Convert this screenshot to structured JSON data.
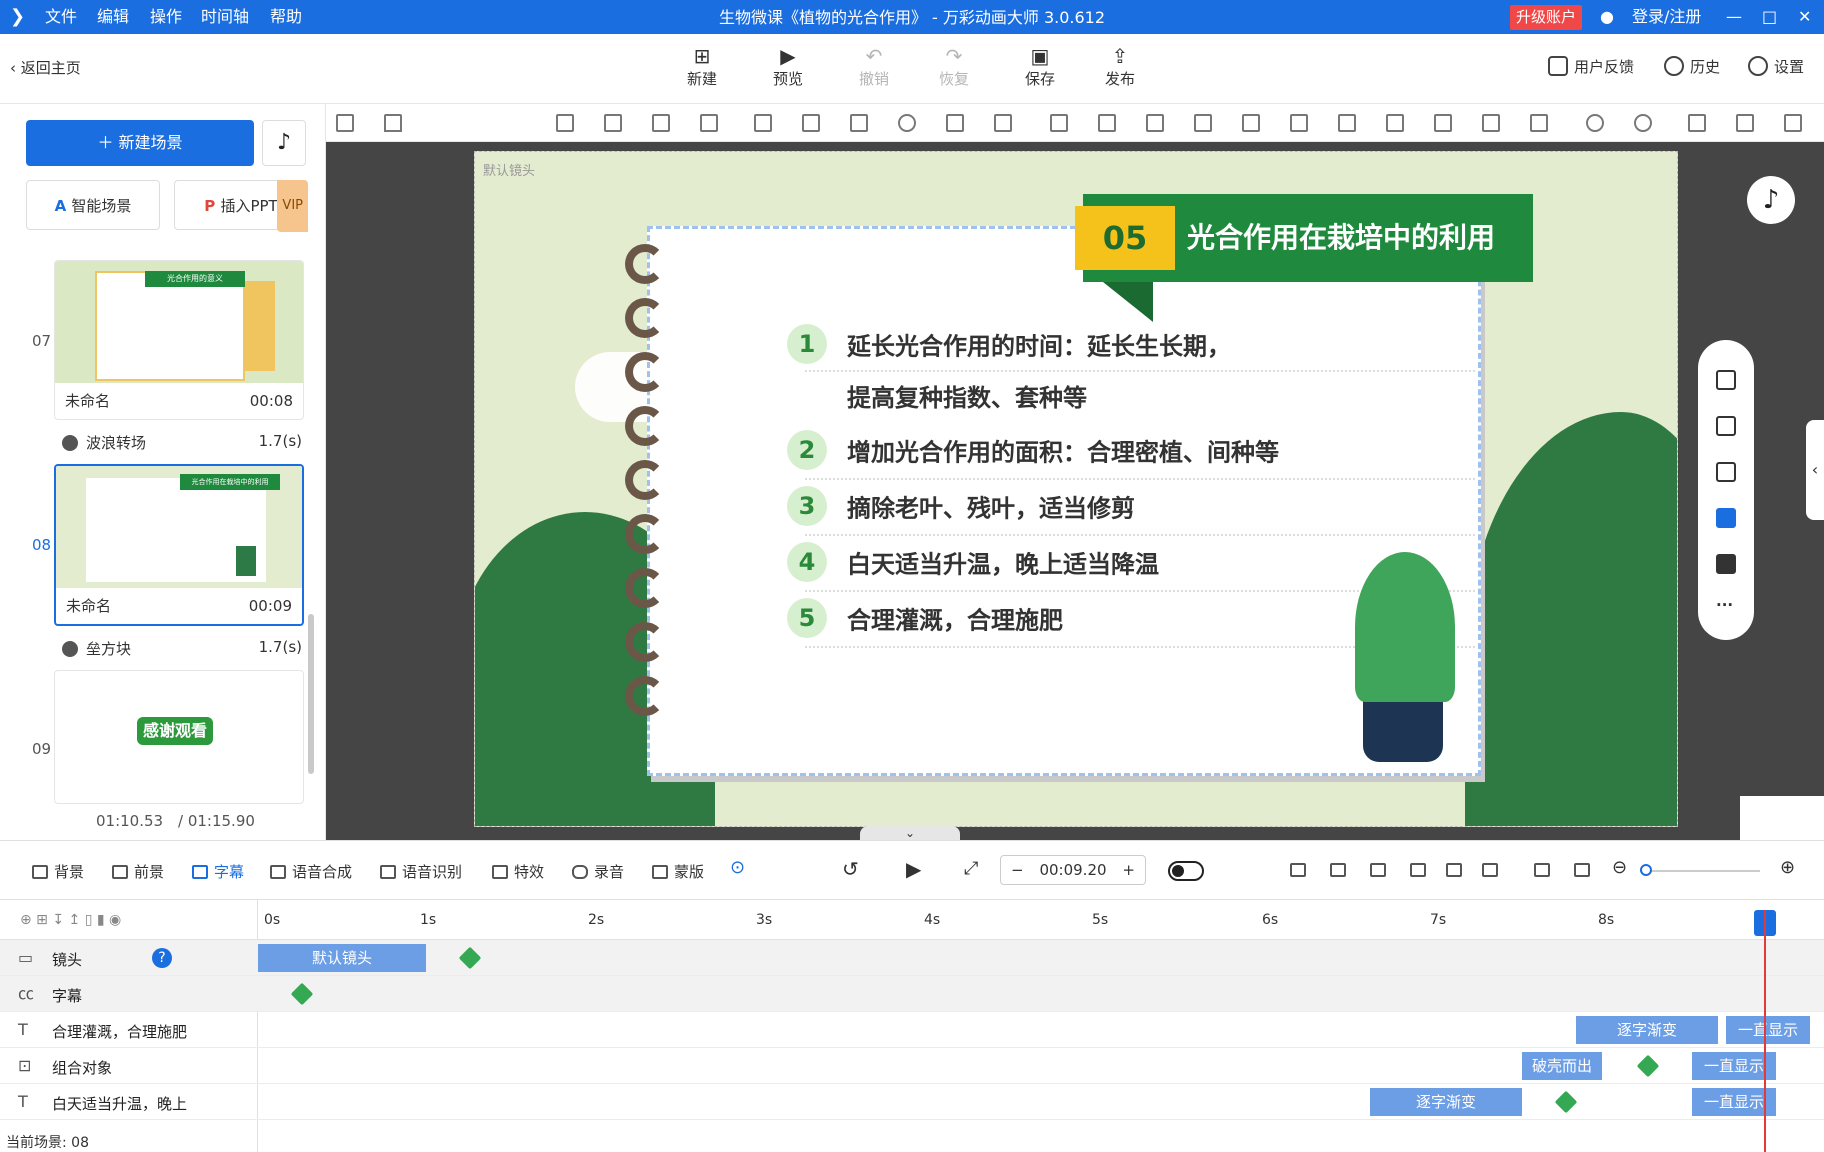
{
  "titlebar": {
    "menus": [
      "文件",
      "编辑",
      "操作",
      "时间轴",
      "帮助"
    ],
    "title": "生物微课《植物的光合作用》 - 万彩动画大师 3.0.612",
    "upgrade": "升级账户",
    "login": "登录/注册"
  },
  "toolbar": {
    "back": "返回主页",
    "buttons": [
      "新建",
      "预览",
      "撤销",
      "恢复",
      "保存",
      "发布"
    ],
    "feedback": "用户反馈",
    "history": "历史",
    "settings": "设置"
  },
  "left": {
    "new_scene": "新建场景",
    "smart_scene": "智能场景",
    "insert_ppt": "插入PPT",
    "vip": "VIP",
    "scenes": [
      {
        "num": "07",
        "name": "未命名",
        "dur": "00:08",
        "transition": "波浪转场",
        "tdur": "1.7(s)",
        "thumb_title": "光合作用的意义"
      },
      {
        "num": "08",
        "name": "未命名",
        "dur": "00:09",
        "transition": "垒方块",
        "tdur": "1.7(s)",
        "thumb_title": "光合作用在栽培中的利用"
      },
      {
        "num": "09",
        "thumb_title": "感谢观看"
      }
    ],
    "time_current": "01:10.53",
    "time_total": "/ 01:15.90"
  },
  "stage": {
    "camera_tag": "默认镜头",
    "banner_num": "05",
    "banner_title": "光合作用在栽培中的利用",
    "items": [
      {
        "n": "1",
        "text": "延长光合作用的时间：延长生长期，"
      },
      {
        "n": "",
        "text": "提高复种指数、套种等"
      },
      {
        "n": "2",
        "text": "增加光合作用的面积：合理密植、间种等"
      },
      {
        "n": "3",
        "text": "摘除老叶、残叶，适当修剪"
      },
      {
        "n": "4",
        "text": "白天适当升温，晚上适当降温"
      },
      {
        "n": "5",
        "text": "合理灌溉，合理施肥"
      }
    ]
  },
  "bottom": {
    "tabs": [
      "背景",
      "前景",
      "字幕",
      "语音合成",
      "语音识别",
      "特效",
      "录音",
      "蒙版"
    ],
    "time": "00:09.20"
  },
  "timeline": {
    "ticks": [
      "0s",
      "1s",
      "2s",
      "3s",
      "4s",
      "5s",
      "6s",
      "7s",
      "8s"
    ],
    "rows": [
      {
        "label": "镜头"
      },
      {
        "label": "字幕"
      },
      {
        "label": "合理灌溉，合理施肥"
      },
      {
        "label": "组合对象"
      },
      {
        "label": "白天适当升温，晚上"
      }
    ],
    "clips": {
      "default_camera": "默认镜头",
      "zhuzi": "逐字渐变",
      "always": "一直显示",
      "burst": "破壳而出"
    },
    "status": "当前场景: 08"
  }
}
